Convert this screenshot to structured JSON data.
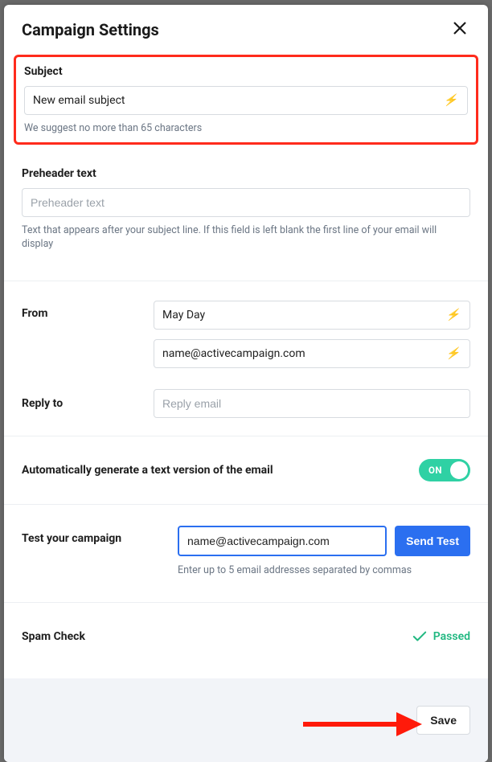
{
  "modal": {
    "title": "Campaign Settings"
  },
  "subject": {
    "label": "Subject",
    "value": "New email subject",
    "hint": "We suggest no more than 65 characters"
  },
  "preheader": {
    "label": "Preheader text",
    "placeholder": "Preheader text",
    "value": "",
    "hint": "Text that appears after your subject line. If this field is left blank the first line of your email will display"
  },
  "from": {
    "label": "From",
    "name": "May Day",
    "email": "name@activecampaign.com"
  },
  "reply_to": {
    "label": "Reply to",
    "placeholder": "Reply email",
    "value": ""
  },
  "text_version": {
    "label": "Automatically generate a text version of the email",
    "state": "ON",
    "on": true
  },
  "test": {
    "label": "Test your campaign",
    "value": "name@activecampaign.com",
    "button": "Send Test",
    "hint": "Enter up to 5 email addresses separated by commas"
  },
  "spam": {
    "label": "Spam Check",
    "status": "Passed"
  },
  "footer": {
    "save": "Save"
  },
  "colors": {
    "highlight": "#ff2b1c",
    "primary": "#2b6ff0",
    "toggle": "#2fd1a4",
    "success": "#21b881"
  }
}
